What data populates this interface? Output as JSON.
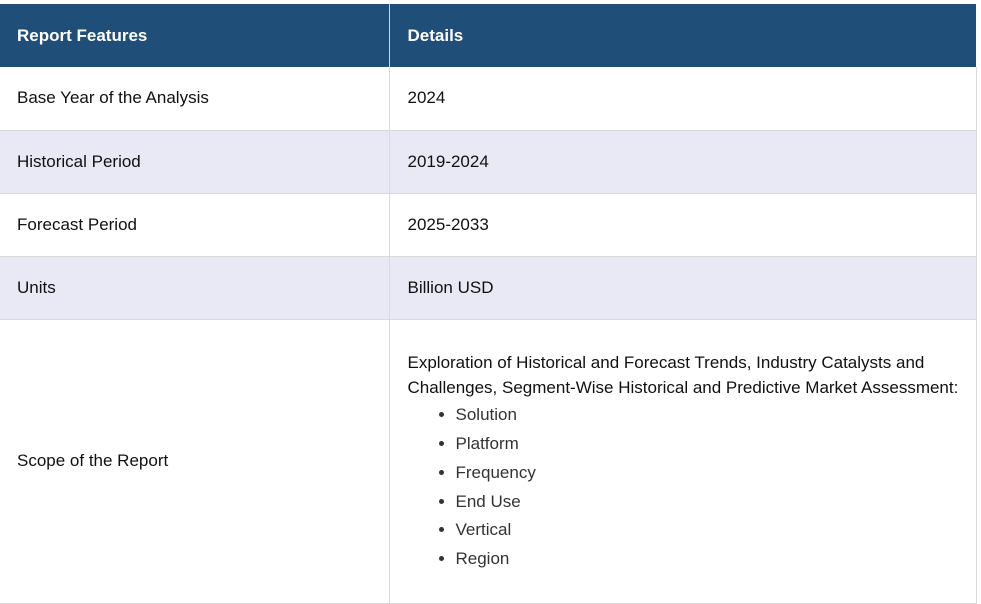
{
  "table": {
    "headers": [
      "Report Features",
      "Details"
    ],
    "rows": [
      {
        "feature": "Base Year of the Analysis",
        "details": "2024"
      },
      {
        "feature": "Historical Period",
        "details": "2019-2024"
      },
      {
        "feature": "Forecast Period",
        "details": "2025-2033"
      },
      {
        "feature": "Units",
        "details": "Billion USD"
      }
    ],
    "scope": {
      "feature": "Scope of the Report",
      "text": "Exploration of Historical and Forecast Trends, Industry Catalysts and Challenges, Segment-Wise Historical and Predictive Market Assessment:",
      "items": [
        "Solution",
        "Platform",
        "Frequency",
        "End Use",
        "Vertical",
        "Region"
      ]
    }
  },
  "colors": {
    "header_bg": "#1f4e79",
    "header_text": "#ffffff",
    "alt_row_bg": "#e8e9f5"
  }
}
